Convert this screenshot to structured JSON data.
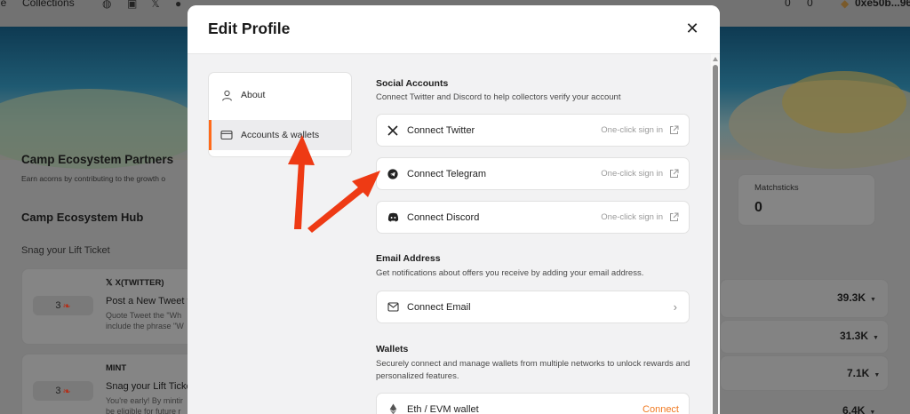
{
  "background": {
    "topbar": {
      "nav_left": "le",
      "nav_collections": "Collections",
      "counter_1": "0",
      "counter_2": "0",
      "wallet_address": "0xe50b...96"
    },
    "partners_title": "Camp Ecosystem Partners",
    "partners_desc": "Earn acorns by contributing to the growth o",
    "hub_title": "Camp Ecosystem Hub",
    "subtitle": "Snag your Lift Ticket",
    "matchsticks_label": "Matchsticks",
    "matchsticks_value": "0",
    "tasks": [
      {
        "reward": "3",
        "platform": "X(TWITTER)",
        "title": "Post a New Tweet v",
        "desc1": "Quote Tweet the \"Wh",
        "desc2": "include the phrase \"W"
      },
      {
        "reward": "3",
        "platform": "MINT",
        "title": "Snag your Lift Ticke",
        "desc1": "You're early! By mintir",
        "desc2": "be eligible for future r"
      }
    ],
    "stats": [
      "39.3K",
      "31.3K",
      "7.1K",
      "6.4K"
    ],
    "colors": {
      "overlay": "#7c7c7c"
    }
  },
  "modal": {
    "title": "Edit Profile",
    "close_icon": "close-icon",
    "nav": [
      {
        "label": "About",
        "icon": "user-icon"
      },
      {
        "label": "Accounts & wallets",
        "icon": "wallet-icon"
      }
    ],
    "social": {
      "title": "Social Accounts",
      "desc": "Connect Twitter and Discord to help collectors verify your account",
      "items": [
        {
          "label": "Connect Twitter",
          "hint": "One-click sign in",
          "icon": "x-logo-icon"
        },
        {
          "label": "Connect Telegram",
          "hint": "One-click sign in",
          "icon": "telegram-icon"
        },
        {
          "label": "Connect Discord",
          "hint": "One-click sign in",
          "icon": "discord-icon"
        }
      ]
    },
    "email": {
      "title": "Email Address",
      "desc": "Get notifications about offers you receive by adding your email address.",
      "label": "Connect Email",
      "icon": "mail-icon"
    },
    "wallets": {
      "title": "Wallets",
      "desc": "Securely connect and manage wallets from multiple networks to unlock rewards and personalized features.",
      "items": [
        {
          "label": "Eth / EVM wallet",
          "action": "Connect",
          "icon": "ethereum-icon"
        }
      ]
    },
    "colors": {
      "accent": "#ff6a1a",
      "connect_text": "#f07a22",
      "annotation_arrow": "#ee3a14"
    }
  }
}
